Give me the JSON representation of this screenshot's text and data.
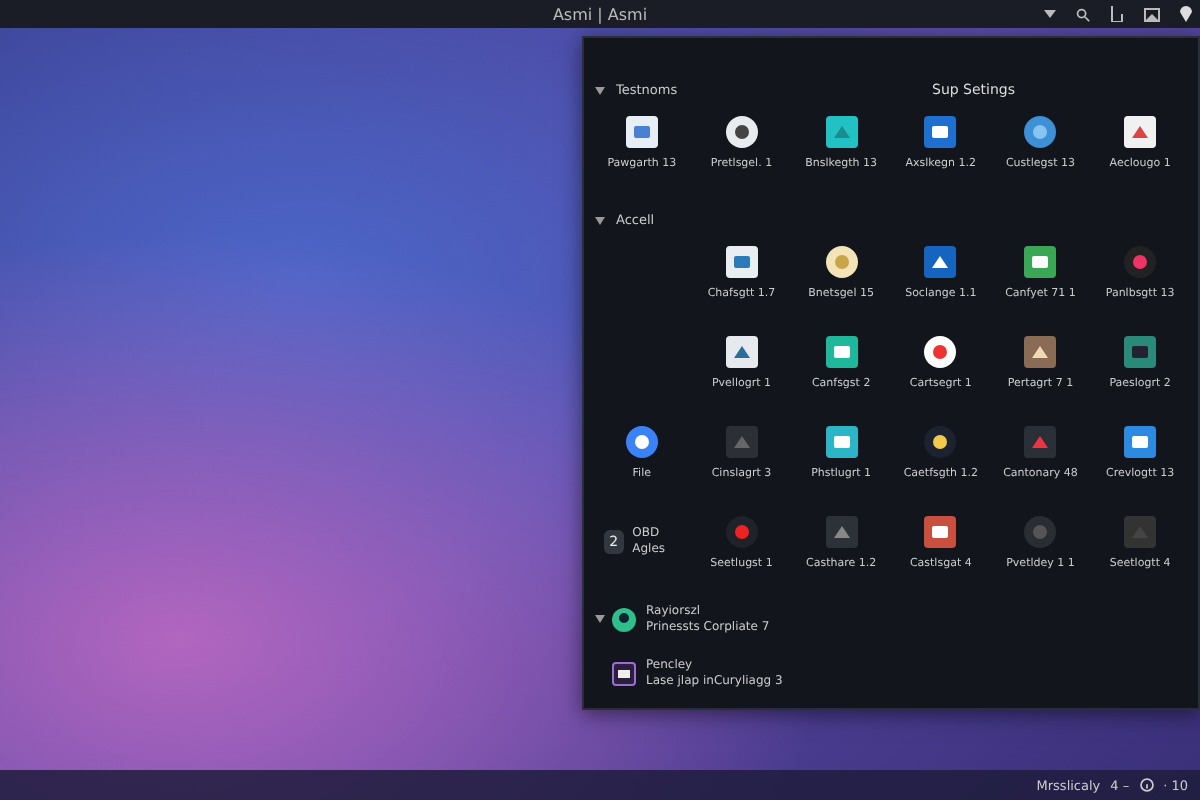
{
  "top_bar": {
    "title": "Asmi | Asmi"
  },
  "panel": {
    "sections": [
      {
        "title": "Testnoms",
        "expanded": true,
        "heading": "Sup Setings",
        "rows": [
          [
            {
              "kind": "app",
              "label": "Pawgarth 13"
            },
            {
              "kind": "app",
              "label": "Pretlsgel. 1"
            },
            {
              "kind": "app",
              "label": "Bnslkegth 13"
            },
            {
              "kind": "app",
              "label": "Axslkegn 1.2"
            },
            {
              "kind": "app",
              "label": "Custlegst 13"
            },
            {
              "kind": "app",
              "label": "Aeclougo 1"
            }
          ]
        ]
      },
      {
        "title": "Accell",
        "expanded": true,
        "rows": [
          [
            {
              "kind": "app",
              "label": "Chafsgtt 1.7"
            },
            {
              "kind": "app",
              "label": "Bnetsgel 15"
            },
            {
              "kind": "app",
              "label": "Soclange 1.1"
            },
            {
              "kind": "app",
              "label": "Canfyet 71 1"
            },
            {
              "kind": "app",
              "label": "Panlbsgtt 13"
            }
          ],
          [
            {
              "kind": "app",
              "label": "Pvellogrt 1"
            },
            {
              "kind": "app",
              "label": "Canfsgst 2"
            },
            {
              "kind": "app",
              "label": "Cartsegrt 1"
            },
            {
              "kind": "app",
              "label": "Pertagrt 7 1"
            },
            {
              "kind": "app",
              "label": "Paeslogrt 2"
            }
          ],
          [
            {
              "kind": "app",
              "label": "File"
            },
            {
              "kind": "app",
              "label": "Cinslagrt 3"
            },
            {
              "kind": "app",
              "label": "Phstlugrt 1"
            },
            {
              "kind": "app",
              "label": "Caetfsgth 1.2"
            },
            {
              "kind": "app",
              "label": "Cantonary 48"
            },
            {
              "kind": "app",
              "label": "Crevlogtt 13"
            }
          ],
          [
            {
              "kind": "badge",
              "count": "2",
              "label": "OBD Agles"
            },
            {
              "kind": "app",
              "label": "Seetlugst 1"
            },
            {
              "kind": "app",
              "label": "Casthare 1.2"
            },
            {
              "kind": "app",
              "label": "Castlsgat 4"
            },
            {
              "kind": "app",
              "label": "Pvetldey 1 1"
            },
            {
              "kind": "app",
              "label": "Seetlogtt 4"
            }
          ]
        ]
      }
    ],
    "recent": {
      "expanded": true,
      "items": [
        {
          "title": "Rayiorszl",
          "subtitle": "Prinessts Corpliate 7"
        },
        {
          "title": "Pencley",
          "subtitle": "Lase jlap inCuryliagg 3"
        }
      ]
    }
  },
  "taskbar": {
    "texts": [
      "Mrsslicaly",
      "4 –"
    ],
    "tail": "· 10"
  }
}
